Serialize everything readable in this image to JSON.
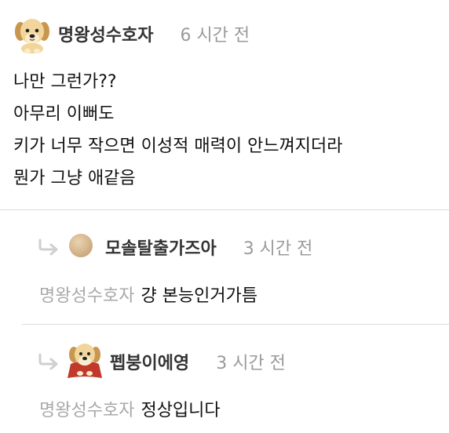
{
  "main_comment": {
    "author": "명왕성수호자",
    "time": "6 시간 전",
    "lines": [
      "나만 그런가??",
      "아무리 이뻐도",
      "키가 너무 작으면 이성적 매력이 안느껴지더라",
      "뭔가 그냥 애같음"
    ]
  },
  "replies": [
    {
      "author": "모솔탈출가즈아",
      "time": "3 시간 전",
      "mention": "명왕성수호자",
      "text": "걍 본능인거가틈"
    },
    {
      "author": "펩붕이에영",
      "time": "3 시간 전",
      "mention": "명왕성수호자",
      "text": "정상입니다"
    }
  ],
  "icons": {
    "reply_arrow": "reply-arrow-icon",
    "main_avatar": "puppy-avatar",
    "reply1_avatar": "tan-circle-avatar",
    "reply2_avatar": "puppy-caped-avatar"
  },
  "colors": {
    "author": "#333333",
    "time": "#9a9a9a",
    "mention": "#a9a9a9",
    "divider": "#dcdcdc",
    "arrow": "#cfcfcf"
  }
}
